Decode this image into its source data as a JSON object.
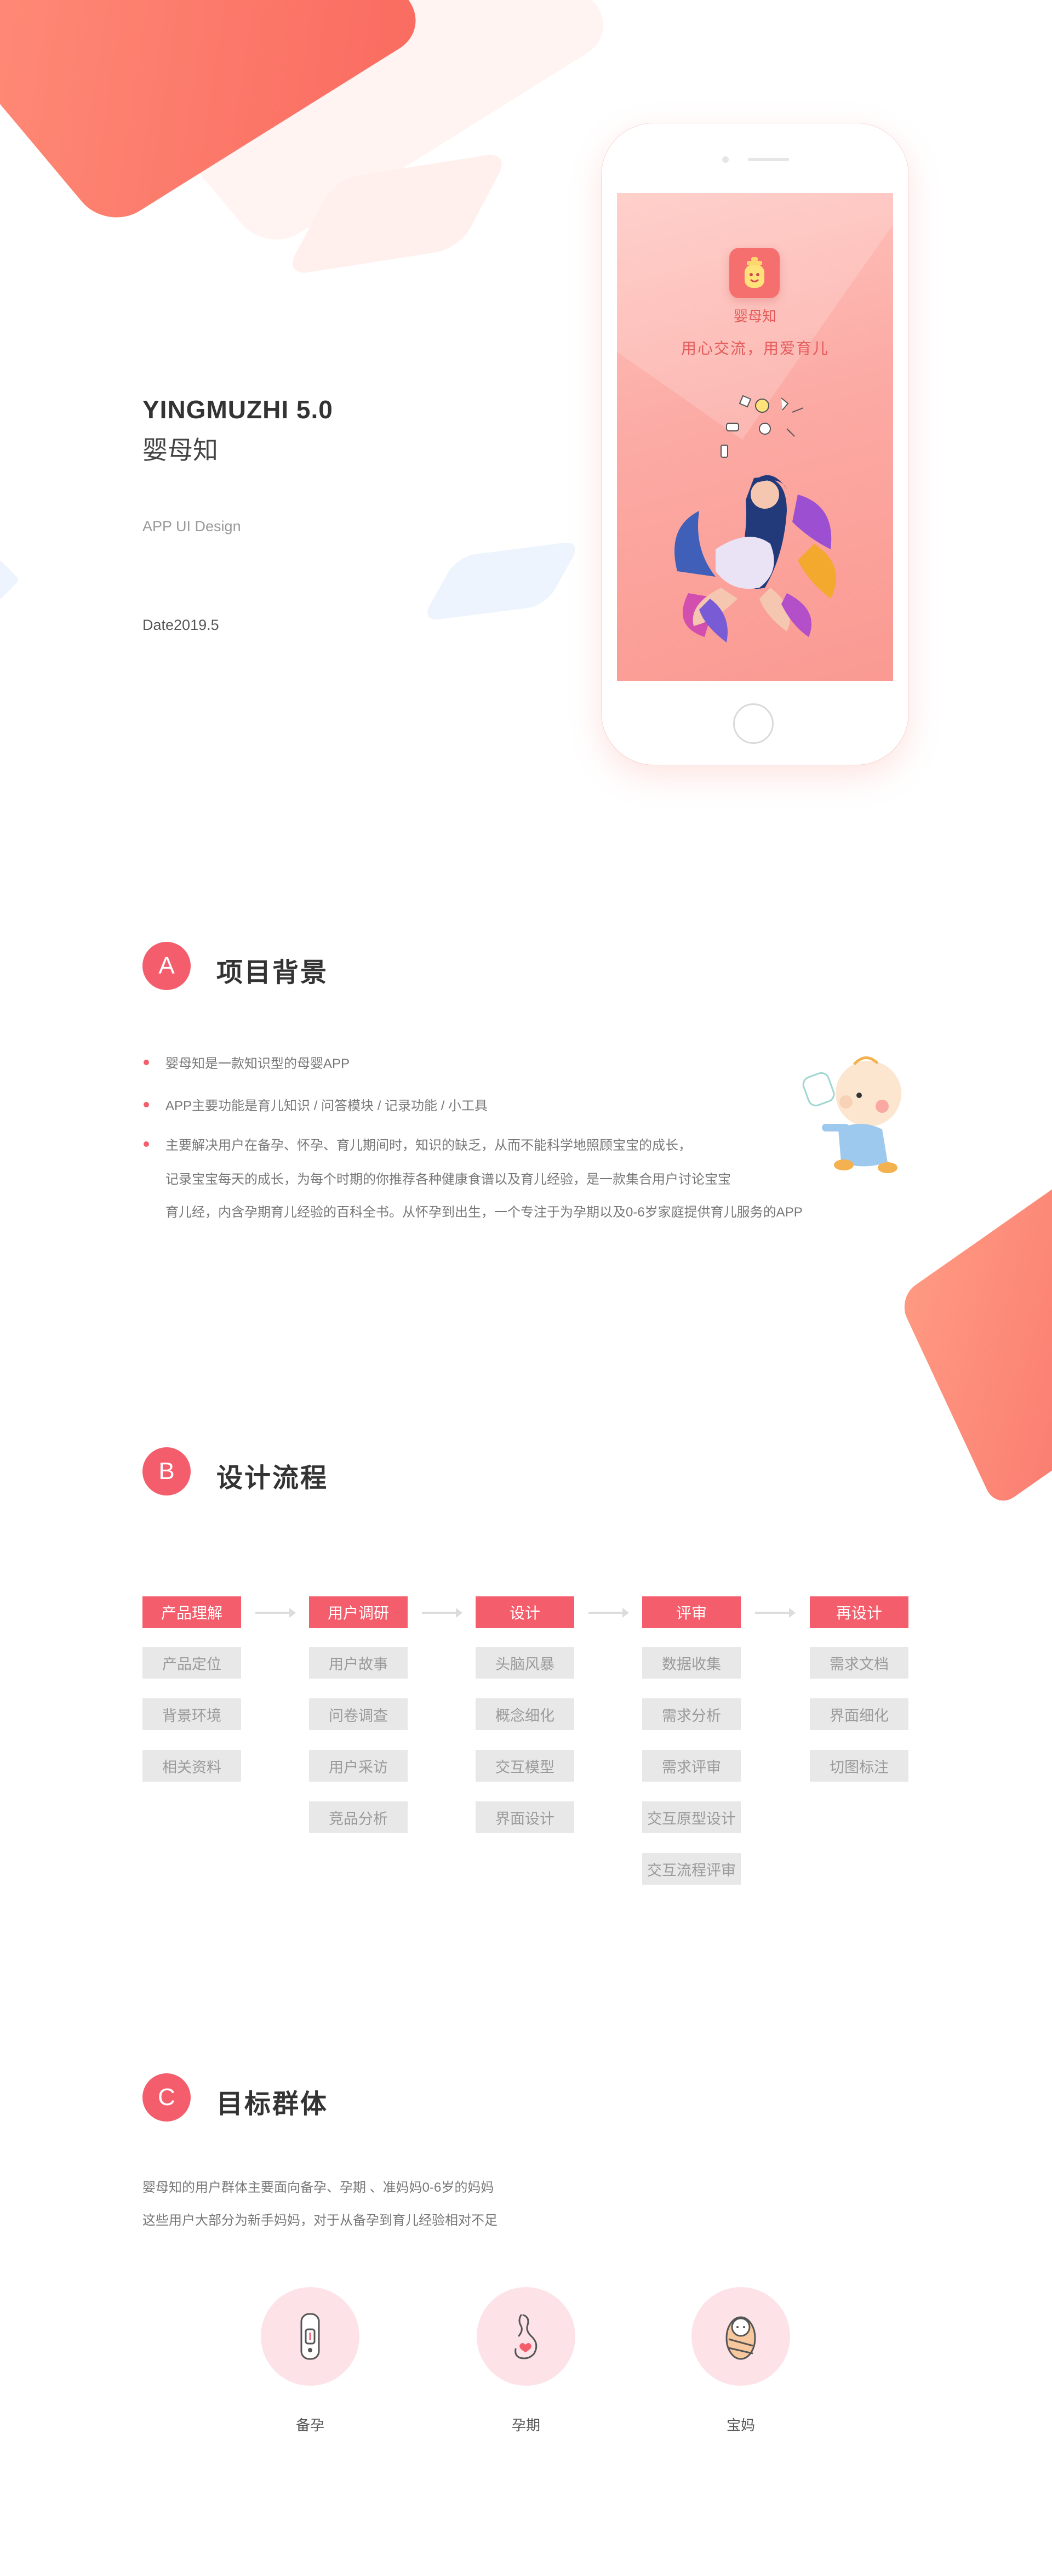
{
  "hero": {
    "title": "YINGMUZHI 5.0",
    "title_cn": "婴母知",
    "subtitle": "APP UI Design",
    "date": "Date2019.5"
  },
  "phone": {
    "app_name": "婴母知",
    "slogan": "用心交流，用爱育儿"
  },
  "section_a": {
    "badge": "A",
    "title": "项目背景",
    "bullets": [
      "婴母知是一款知识型的母婴APP",
      "APP主要功能是育儿知识 / 问答模块 / 记录功能 / 小工具",
      "主要解决用户在备孕、怀孕、育儿期间时，知识的缺乏，从而不能科学地照顾宝宝的成长，"
    ],
    "continuation": [
      "记录宝宝每天的成长，为每个时期的你推荐各种健康食谱以及育儿经验，是一款集合用户讨论宝宝",
      "育儿经，内含孕期育儿经验的百科全书。从怀孕到出生，一个专注于为孕期以及0-6岁家庭提供育儿服务的APP"
    ]
  },
  "section_b": {
    "badge": "B",
    "title": "设计流程",
    "columns": [
      {
        "head": "产品理解",
        "items": [
          "产品定位",
          "背景环境",
          "相关资料"
        ]
      },
      {
        "head": "用户调研",
        "items": [
          "用户故事",
          "问卷调查",
          "用户采访",
          "竞品分析"
        ]
      },
      {
        "head": "设计",
        "items": [
          "头脑风暴",
          "概念细化",
          "交互模型",
          "界面设计"
        ]
      },
      {
        "head": "评审",
        "items": [
          "数据收集",
          "需求分析",
          "需求评审",
          "交互原型设计",
          "交互流程评审"
        ]
      },
      {
        "head": "再设计",
        "items": [
          "需求文档",
          "界面细化",
          "切图标注"
        ]
      }
    ]
  },
  "section_c": {
    "badge": "C",
    "title": "目标群体",
    "lines": [
      "婴母知的用户群体主要面向备孕、孕期 、准妈妈0-6岁的妈妈",
      "这些用户大部分为新手妈妈，对于从备孕到育儿经验相对不足"
    ],
    "groups": [
      {
        "label": "备孕",
        "icon": "pregnancy-test-icon"
      },
      {
        "label": "孕期",
        "icon": "pregnant-belly-icon"
      },
      {
        "label": "宝妈",
        "icon": "swaddled-baby-icon"
      }
    ]
  },
  "colors": {
    "accent": "#f45d6b",
    "accent_light": "#fde3e7",
    "grey_box": "#e8e8e8"
  }
}
